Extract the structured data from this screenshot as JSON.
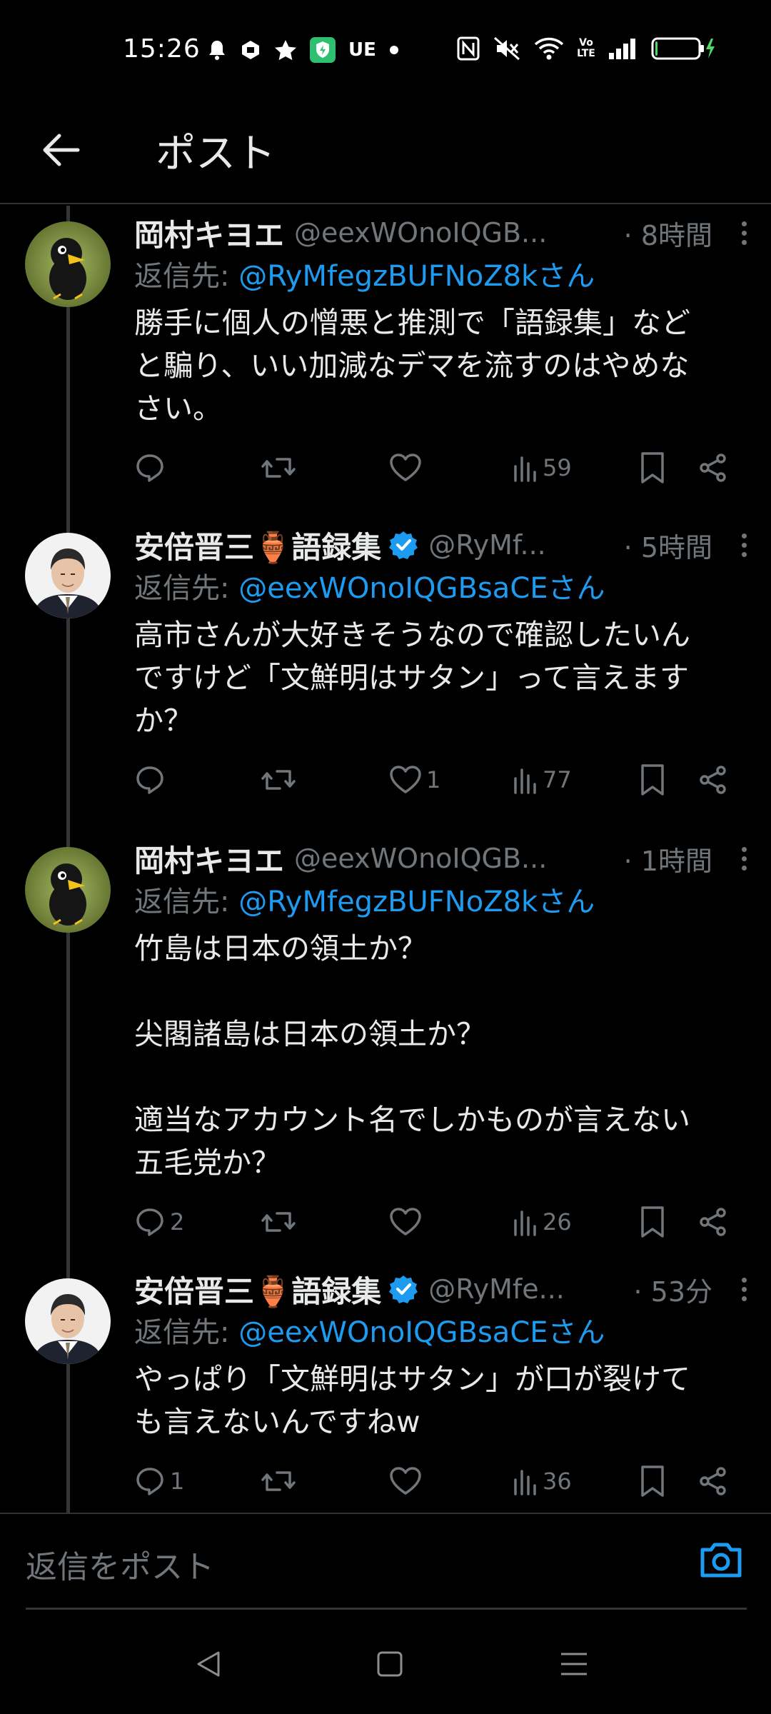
{
  "status_bar": {
    "time": "15:26",
    "carrier_mark": "UE",
    "left_icons": [
      "notification-bell-icon",
      "app-icon",
      "star-icon",
      "shield-icon"
    ],
    "right_icons": [
      "nfc-icon",
      "mute-icon",
      "wifi-icon",
      "volte-icon",
      "signal-icon",
      "battery-icon"
    ],
    "volte_label": "Vo LTE",
    "battery_level": 0.05
  },
  "header": {
    "title": "ポスト"
  },
  "posts": [
    {
      "name": "岡村キヨエ",
      "verified": false,
      "handle": "@eexWOnoIQGB...",
      "time": "· 8時間",
      "reply_prefix": "返信先: ",
      "reply_mention": "@RyMfegzBUFNoZ8kさん",
      "text": "勝手に個人の憎悪と推測で「語録集」など\nと騙り、いい加減なデマを流すのはやめな\nさい。",
      "replies": "",
      "reposts": "",
      "likes": "",
      "views": "59",
      "avatar": "crow-avatar"
    },
    {
      "name": "安倍晋三🏺語録集",
      "verified": true,
      "handle": "@RyMf...",
      "time": "· 5時間",
      "reply_prefix": "返信先: ",
      "reply_mention": "@eexWOnoIQGBsaCEさん",
      "text": "高市さんが大好きそうなので確認したいん\nですけど「文鮮明はサタン」って言えます\nか？",
      "replies": "",
      "reposts": "",
      "likes": "1",
      "views": "77",
      "avatar": "portrait-avatar"
    },
    {
      "name": "岡村キヨエ",
      "verified": false,
      "handle": "@eexWOnoIQGB...",
      "time": "· 1時間",
      "reply_prefix": "返信先: ",
      "reply_mention": "@RyMfegzBUFNoZ8kさん",
      "text": "竹島は日本の領土か？\n\n尖閣諸島は日本の領土か？\n\n適当なアカウント名でしかものが言えない\n五毛党か？",
      "replies": "2",
      "reposts": "",
      "likes": "",
      "views": "26",
      "avatar": "crow-avatar"
    },
    {
      "name": "安倍晋三🏺語録集",
      "verified": true,
      "handle": "@RyMfe...",
      "time": "· 53分",
      "reply_prefix": "返信先: ",
      "reply_mention": "@eexWOnoIQGBsaCEさん",
      "text": "やっぱり「文鮮明はサタン」が口が裂けて\nも言えないんですねw",
      "replies": "1",
      "reposts": "",
      "likes": "",
      "views": "36",
      "avatar": "portrait-avatar"
    }
  ],
  "reply_bar": {
    "placeholder": "返信をポスト"
  },
  "colors": {
    "background": "#000000",
    "text": "#e7e9ea",
    "secondary": "#71767b",
    "accent": "#1d9bf0",
    "divider": "#2f3336",
    "battery_charge": "#4cd964"
  }
}
